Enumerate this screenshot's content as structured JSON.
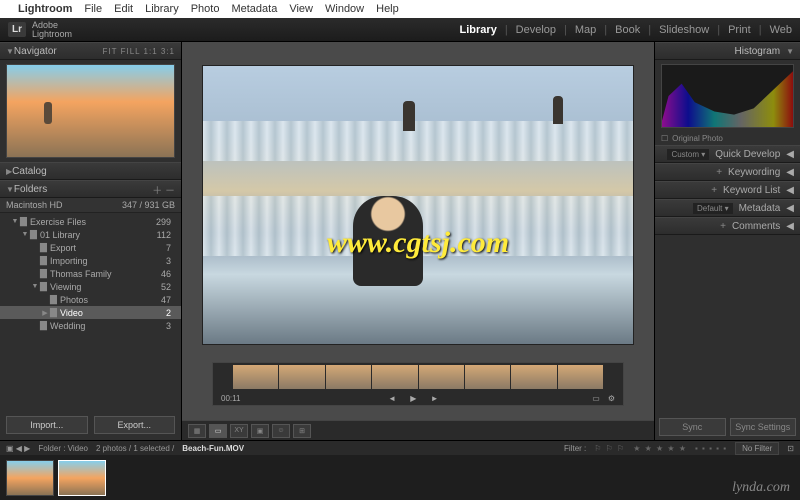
{
  "menubar": {
    "app": "Lightroom",
    "items": [
      "File",
      "Edit",
      "Library",
      "Photo",
      "Metadata",
      "View",
      "Window",
      "Help"
    ]
  },
  "brand": {
    "logo": "Lr",
    "line1": "Adobe",
    "line2": "Lightroom"
  },
  "modules": [
    "Library",
    "Develop",
    "Map",
    "Book",
    "Slideshow",
    "Print",
    "Web"
  ],
  "active_module": "Library",
  "left": {
    "navigator": {
      "title": "Navigator",
      "opts": "FIT  FILL  1:1  3:1"
    },
    "catalog": "Catalog",
    "folders": {
      "title": "Folders",
      "volume": {
        "name": "Macintosh HD",
        "space": "347 / 931 GB"
      },
      "tree": [
        {
          "depth": 1,
          "exp": "▼",
          "name": "Exercise Files",
          "count": "299"
        },
        {
          "depth": 2,
          "exp": "▼",
          "name": "01 Library",
          "count": "112"
        },
        {
          "depth": 3,
          "exp": "",
          "name": "Export",
          "count": "7"
        },
        {
          "depth": 3,
          "exp": "",
          "name": "Importing",
          "count": "3"
        },
        {
          "depth": 3,
          "exp": "",
          "name": "Thomas Family",
          "count": "46"
        },
        {
          "depth": 3,
          "exp": "▼",
          "name": "Viewing",
          "count": "52"
        },
        {
          "depth": 4,
          "exp": "",
          "name": "Photos",
          "count": "47"
        },
        {
          "depth": 4,
          "exp": "▶",
          "name": "Video",
          "count": "2",
          "sel": true
        },
        {
          "depth": 3,
          "exp": "",
          "name": "Wedding",
          "count": "3"
        }
      ]
    },
    "import_btn": "Import...",
    "export_btn": "Export..."
  },
  "center": {
    "watermark": "www.cgtsj.com",
    "timecode": "00:11"
  },
  "right": {
    "histogram": "Histogram",
    "original": "Original Photo",
    "panels": [
      {
        "sel": "Custom",
        "name": "Quick Develop"
      },
      {
        "sel": "",
        "name": "Keywording"
      },
      {
        "sel": "",
        "name": "Keyword List"
      },
      {
        "sel": "Default",
        "name": "Metadata"
      },
      {
        "sel": "",
        "name": "Comments"
      }
    ],
    "sync": "Sync",
    "sync_settings": "Sync Settings"
  },
  "filmstrip": {
    "nav": "▣ ◀ ▶",
    "path": "Folder : Video",
    "info": "2 photos / 1 selected /",
    "filename": "Beach-Fun.MOV",
    "filter_label": "Filter :",
    "nofilter": "No Filter"
  },
  "lynda": "lynda.com"
}
